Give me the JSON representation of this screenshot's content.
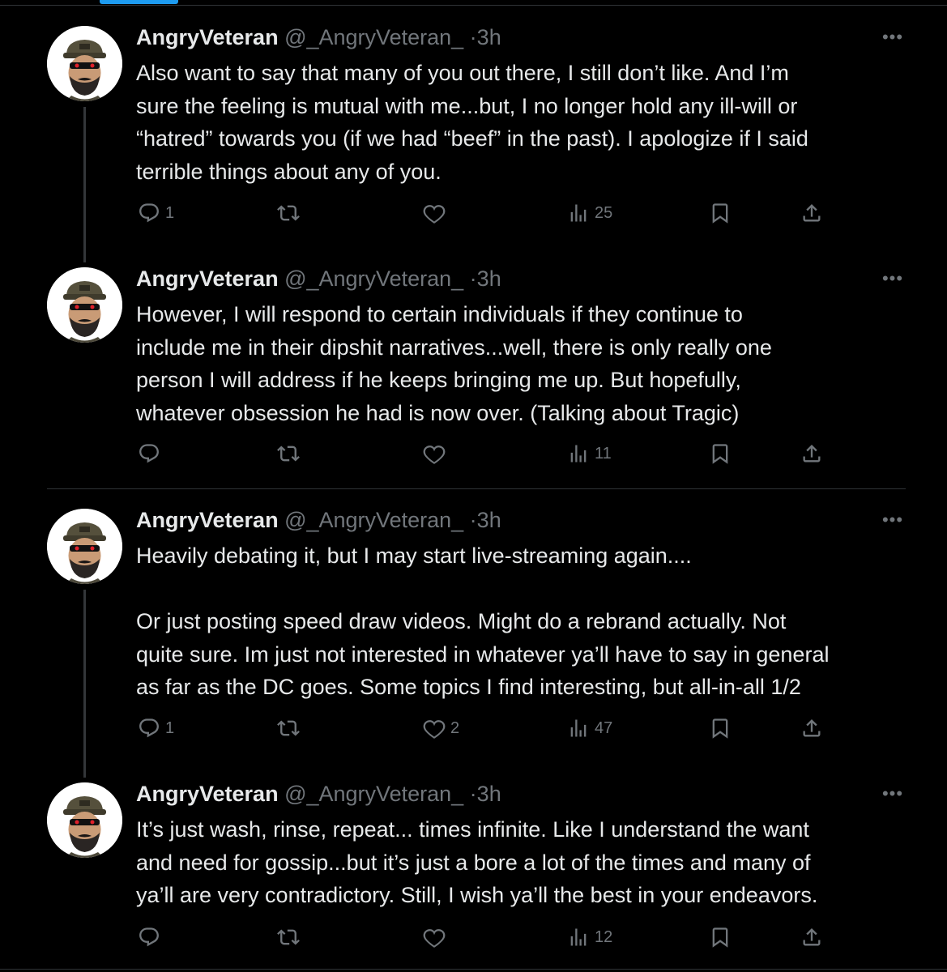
{
  "tweets": [
    {
      "name": "AngryVeteran",
      "handle": "@_AngryVeteran_",
      "separator": "·",
      "time": "3h",
      "more": "•••",
      "text": "Also want to say that many of you out there, I still don’t like. And I’m\nsure the feeling is mutual with me...but, I no longer hold any ill-will or\n“hatred” towards you (if we had “beef” in the past). I apologize if I said\nterrible things about any of you.",
      "replies": "1",
      "retweets": "",
      "likes": "",
      "views": "25"
    },
    {
      "name": "AngryVeteran",
      "handle": "@_AngryVeteran_",
      "separator": "·",
      "time": "3h",
      "more": "•••",
      "text": "However, I will respond to certain individuals if they continue to\ninclude me in their dipshit narratives...well, there is only really one\nperson I will address if he keeps bringing me up. But hopefully,\nwhatever obsession he had is now over. (Talking about Tragic)",
      "replies": "",
      "retweets": "",
      "likes": "",
      "views": "11"
    },
    {
      "name": "AngryVeteran",
      "handle": "@_AngryVeteran_",
      "separator": "·",
      "time": "3h",
      "more": "•••",
      "text": "Heavily debating it, but I may start live-streaming again....\n\nOr just posting speed draw videos. Might do a rebrand actually. Not\nquite sure. Im just not interested in whatever ya’ll have to say in general\nas far as the DC goes. Some topics I find interesting, but all-in-all 1/2",
      "replies": "1",
      "retweets": "",
      "likes": "2",
      "views": "47"
    },
    {
      "name": "AngryVeteran",
      "handle": "@_AngryVeteran_",
      "separator": "·",
      "time": "3h",
      "more": "•••",
      "text": "It’s just wash, rinse, repeat... times infinite. Like I understand the want\nand need for gossip...but it’s just a bore a lot of the times and many of\nya’ll are very contradictory. Still, I wish ya’ll the best in your endeavors.",
      "replies": "",
      "retweets": "",
      "likes": "",
      "views": "12"
    }
  ],
  "colors": {
    "background": "#000000",
    "text": "#e7e9ea",
    "muted": "#71767b",
    "accent": "#1d9bf0",
    "divider": "#2f3336"
  },
  "icons": [
    "reply-icon",
    "retweet-icon",
    "like-icon",
    "views-icon",
    "bookmark-icon",
    "share-icon",
    "more-icon"
  ]
}
